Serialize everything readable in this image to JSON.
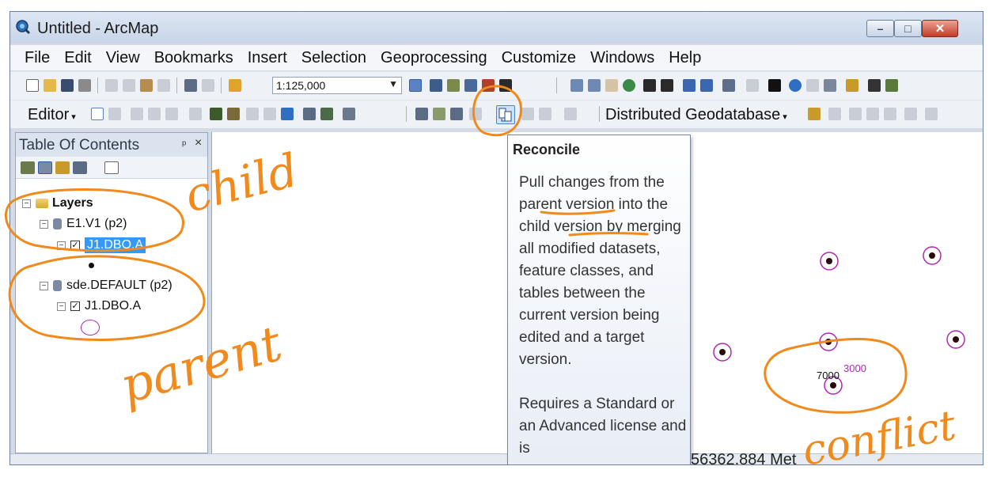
{
  "window": {
    "title": "Untitled - ArcMap",
    "controls": {
      "minimize": "–",
      "maximize": "□",
      "close": "✕"
    }
  },
  "menu": [
    "File",
    "Edit",
    "View",
    "Bookmarks",
    "Insert",
    "Selection",
    "Geoprocessing",
    "Customize",
    "Windows",
    "Help"
  ],
  "toolbar1": {
    "scale": "1:125,000",
    "scale_arrow": "▼"
  },
  "toolbar2": {
    "editor_label": "Editor",
    "distributed_label": "Distributed Geodatabase"
  },
  "toc": {
    "title": "Table Of Contents",
    "pin": "ᵖ",
    "close": "×",
    "root": "Layers",
    "items": [
      {
        "label": "E1.V1 (p2)"
      },
      {
        "label": "J1.DBO.A"
      },
      {
        "label": "sde.DEFAULT (p2)"
      },
      {
        "label": "J1.DBO.A"
      }
    ]
  },
  "tooltip": {
    "title": "Reconcile",
    "body": "Pull changes from the parent version into the child version by merging all modified datasets, feature classes, and tables between the current version being edited and a target version.",
    "footer": "Requires a Standard or an Advanced license and is"
  },
  "map": {
    "label_a": "7000",
    "label_b": "3000"
  },
  "status": {
    "coords": "56362.884 Met"
  },
  "annotations": {
    "child": "child",
    "parent": "parent",
    "conflict": "conflict"
  },
  "colors": {
    "annotation": "#f08a1c",
    "point_fill": "#2a0a0a",
    "point_ring": "#b226b2",
    "selection": "#3399ff"
  }
}
